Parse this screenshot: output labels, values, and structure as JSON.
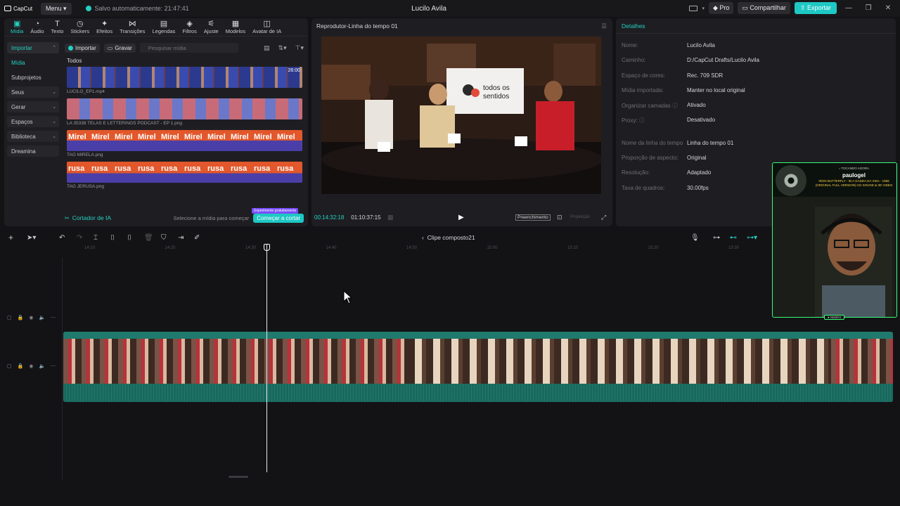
{
  "app": {
    "logo": "CapCut",
    "menu_label": "Menu",
    "autosave": "Salvo automaticamente: 21:47:41",
    "project_title": "Lucilo Avila",
    "pro_label": "Pro",
    "share_label": "Compartilhar",
    "export_label": "Exportar"
  },
  "tool_tabs": [
    {
      "label": "Mídia",
      "icon": "▣"
    },
    {
      "label": "Áudio",
      "icon": "◔"
    },
    {
      "label": "Texto",
      "icon": "T"
    },
    {
      "label": "Stickers",
      "icon": "◷"
    },
    {
      "label": "Efeitos",
      "icon": "✦"
    },
    {
      "label": "Transições",
      "icon": "⋈"
    },
    {
      "label": "Legendas",
      "icon": "▤"
    },
    {
      "label": "Filtros",
      "icon": "◈"
    },
    {
      "label": "Ajuste",
      "icon": "⚟"
    },
    {
      "label": "Modelos",
      "icon": "▦"
    },
    {
      "label": "Avatar de IA",
      "icon": "◫"
    }
  ],
  "side_nav": {
    "importar": "Importar",
    "midia": "Mídia",
    "subprojetos": "Subprojetos",
    "seus": "Seus",
    "gerar": "Gerar",
    "espacos": "Espaços",
    "biblioteca": "Biblioteca",
    "dreamina": "Dreamina"
  },
  "media_toolbar": {
    "import_label": "Importar",
    "record_label": "Gravar",
    "search_placeholder": "Pesquisar mídia"
  },
  "media": {
    "section": "Todos",
    "clips": [
      {
        "name": "LUCILO_EP1.mp4",
        "duration": "26:00"
      },
      {
        "name": "LA 35338 TELAS E LETTERINGS PODCAST - EP 1.png"
      },
      {
        "name": "TAG MIRELA.png",
        "thumb_text": "Mirel"
      },
      {
        "name": "TAG JERUSA.png",
        "thumb_text": "rusa"
      }
    ]
  },
  "ai_cutter": {
    "label": "Cortador de IA",
    "hint": "Selecione a mídia para começar",
    "start_label": "Começar a cortar",
    "badge": "Experimente gratuitamente"
  },
  "player": {
    "title": "Reprodutor-Linha do tempo 01",
    "current_time": "00:14:32:18",
    "total_time": "01:10:37:15",
    "fill_label": "Preenchimento",
    "proportion_label": "Proporção"
  },
  "details": {
    "header": "Detalhes",
    "rows": [
      {
        "key": "Nome:",
        "value": "Lucilo Avila"
      },
      {
        "key": "Caminho:",
        "value": "D:/CapCut Drafts/Lucilo Avila"
      },
      {
        "key": "Espaço de cores:",
        "value": "Rec. 709 SDR"
      },
      {
        "key": "Mídia importada:",
        "value": "Manter no local original"
      },
      {
        "key": "Organizar camadas ⓘ",
        "value": "Ativado"
      },
      {
        "key": "Proxy: ⓘ",
        "value": "Desativado"
      },
      {
        "key": "Nome da linha do tempo",
        "value": "Linha do tempo 01"
      },
      {
        "key": "Proporção de aspecto:",
        "value": "Original"
      },
      {
        "key": "Resolução:",
        "value": "Adaptado"
      },
      {
        "key": "Taxa de quadros:",
        "value": "30.00fps"
      }
    ]
  },
  "timeline": {
    "compound_title": "Clipe composto21",
    "ruler_ticks": [
      "14:10",
      "14:20",
      "14:30",
      "14:40",
      "14:50",
      "15:00",
      "15:10",
      "15:20",
      "15:30"
    ]
  },
  "webcam": {
    "np_title": "♪ TOCANDO AGORA",
    "np_user": "paulogel",
    "np_song": "IRON BUTTERFLY - IN A GADDA DA VIDA - 1968 (ORIGINAL FULL VERSION) CD SOUND & 3D VIDEO",
    "tag": "● NEBRX"
  },
  "colors": {
    "accent": "#1ec8c4",
    "cam_border": "#39ff7a"
  }
}
